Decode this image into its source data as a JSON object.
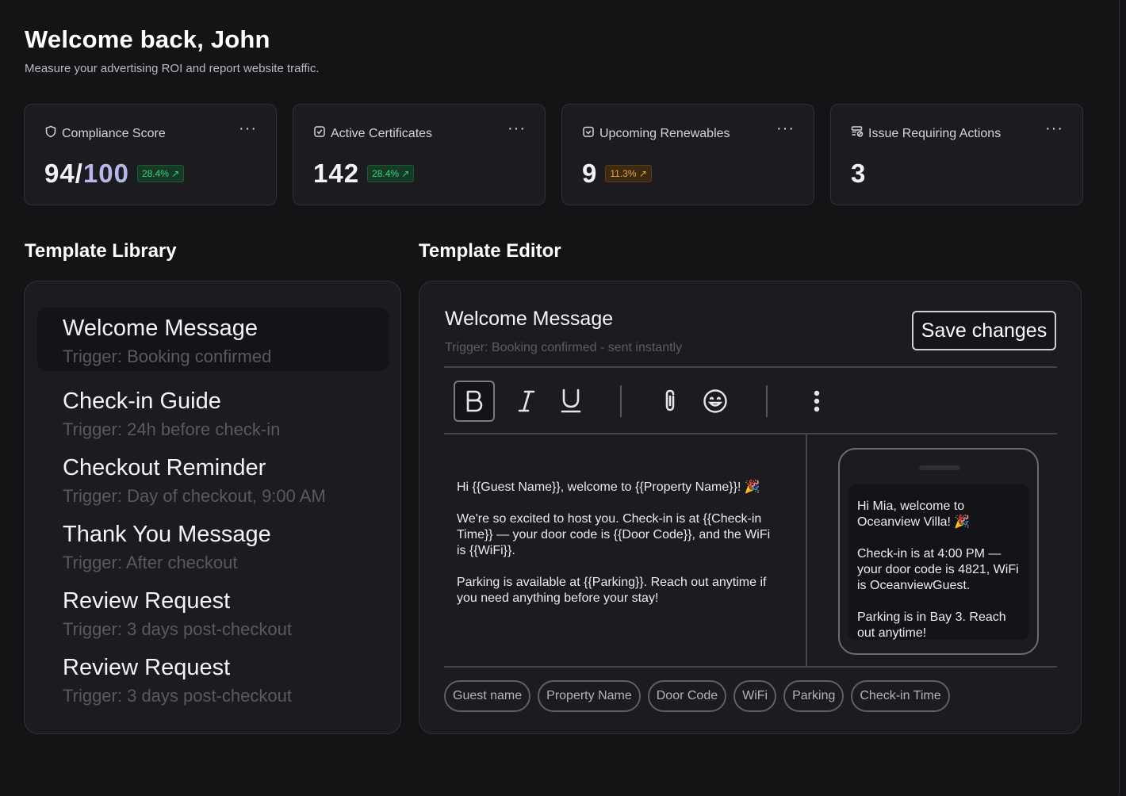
{
  "header": {
    "title": "Welcome back, John",
    "subtitle": "Measure your advertising ROI and report website traffic."
  },
  "stats": [
    {
      "label": "Compliance Score",
      "value": "94/",
      "value_muted": "100",
      "badge": "28.4% ↗",
      "badge_color": "#3ccf7c",
      "icon": "shield-icon"
    },
    {
      "label": "Active Certificates",
      "value": "142",
      "badge": "28.4% ↗",
      "badge_color": "#3ccf7c",
      "icon": "check-square-icon"
    },
    {
      "label": "Upcoming Renewables",
      "value": "9",
      "badge": "11.3% ↗",
      "badge_color": "#f0a03c",
      "icon": "calendar-check-icon"
    },
    {
      "label": "Issue Requiring Actions",
      "value": "3",
      "icon": "stack-alert-icon"
    }
  ],
  "more_glyph": "···",
  "library": {
    "title": "Template Library",
    "items": [
      {
        "title": "Welcome Message",
        "trigger": "Trigger: Booking confirmed"
      },
      {
        "title": "Check-in Guide",
        "trigger": "Trigger: 24h before check-in"
      },
      {
        "title": "Checkout Reminder",
        "trigger": "Trigger: Day of checkout, 9:00 AM"
      },
      {
        "title": "Thank You Message",
        "trigger": "Trigger: After checkout"
      },
      {
        "title": "Review Request",
        "trigger": "Trigger: 3 days post-checkout"
      },
      {
        "title": "Review Request",
        "trigger": "Trigger: 3 days post-checkout"
      }
    ]
  },
  "editor": {
    "section_title": "Template Editor",
    "title": "Welcome Message",
    "subtitle": "Trigger: Booking confirmed - sent instantly",
    "save_label": "Save changes",
    "body": [
      "Hi {{Guest Name}}, welcome to {{Property Name}}! 🎉",
      "We're so excited to host you. Check-in is at {{Check-in Time}} — your door code is {{Door Code}}, and the WiFi is {{WiFi}}.",
      "Parking is available at {{Parking}}. Reach out anytime if you need anything before your stay!"
    ],
    "preview": [
      "Hi Mia, welcome to Oceanview Villa! 🎉",
      "Check-in is at 4:00 PM — your door code is 4821, WiFi is OceanviewGuest.",
      "Parking is in Bay 3. Reach out anytime!"
    ],
    "chips": [
      "Guest name",
      "Property Name",
      "Door Code",
      "WiFi",
      "Parking",
      "Check-in Time"
    ]
  },
  "colors": {
    "background": "#141417",
    "card": "#1b1b20",
    "accent_muted": "#b4b7e8",
    "positive": "#3ccf7c",
    "warning": "#f0a03c"
  }
}
